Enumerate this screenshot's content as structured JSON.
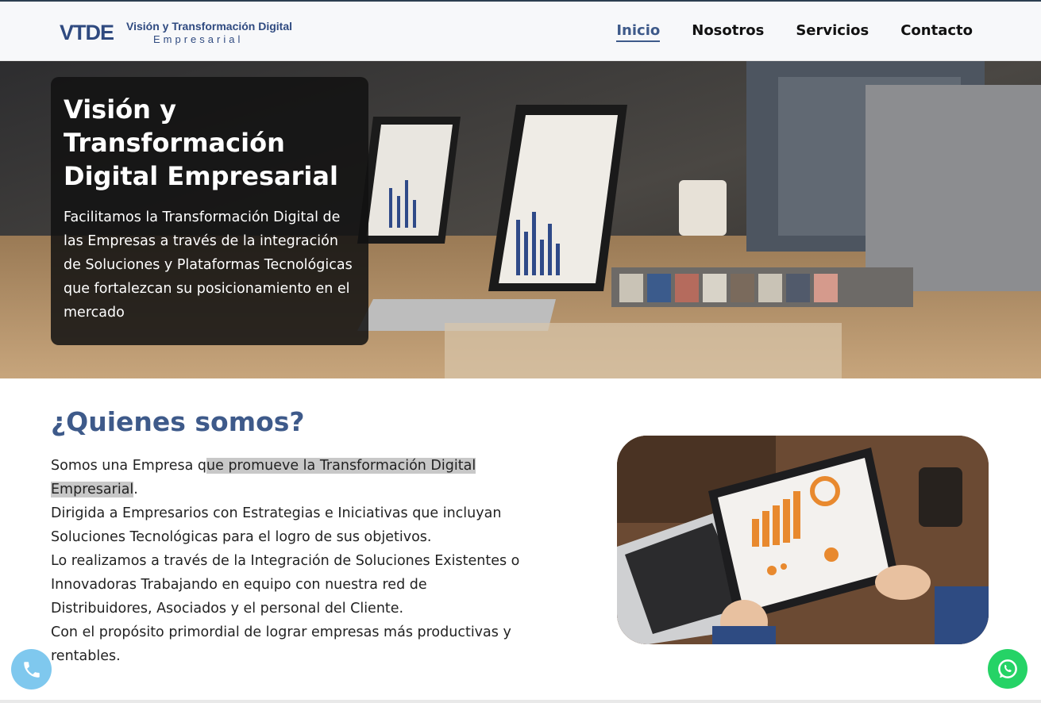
{
  "header": {
    "logo": {
      "mark": "VTDE",
      "title": "Visión y Transformación Digital",
      "subtitle": "Empresarial"
    },
    "nav": [
      {
        "label": "Inicio",
        "active": true
      },
      {
        "label": "Nosotros",
        "active": false
      },
      {
        "label": "Servicios",
        "active": false
      },
      {
        "label": "Contacto",
        "active": false
      }
    ]
  },
  "hero": {
    "title": "Visión y Transformación Digital Empresarial",
    "text": "Facilitamos la Transformación Digital de las Empresas a través de la integración de Soluciones y Plataformas Tecnológicas que fortalezcan su posicionamiento en el mercado",
    "image": "office-meeting-laptops-photo"
  },
  "about": {
    "heading": "¿Quienes somos?",
    "p1_plain": "Somos una Empresa q",
    "p1_highlight": "ue promueve la Transformación Digital Empresarial",
    "p1_end": ".",
    "p2": "Dirigida a Empresarios con Estrategias e Iniciativas que incluyan Soluciones Tecnológicas para el logro de sus objetivos.",
    "p3": "Lo realizamos a través de la Integración de Soluciones Existentes o Innovadoras Trabajando en equipo con nuestra red de Distribuidores, Asociados y el personal del Cliente.",
    "p4": "Con el propósito primordial de lograr empresas más productivas y rentables.",
    "image": "tablet-dashboard-photo"
  },
  "floating": {
    "phone_icon": "phone-icon",
    "whatsapp_icon": "whatsapp-icon"
  },
  "colors": {
    "accent": "#3e5a8a",
    "whatsapp": "#25d366",
    "phone": "#7fc8ee"
  }
}
